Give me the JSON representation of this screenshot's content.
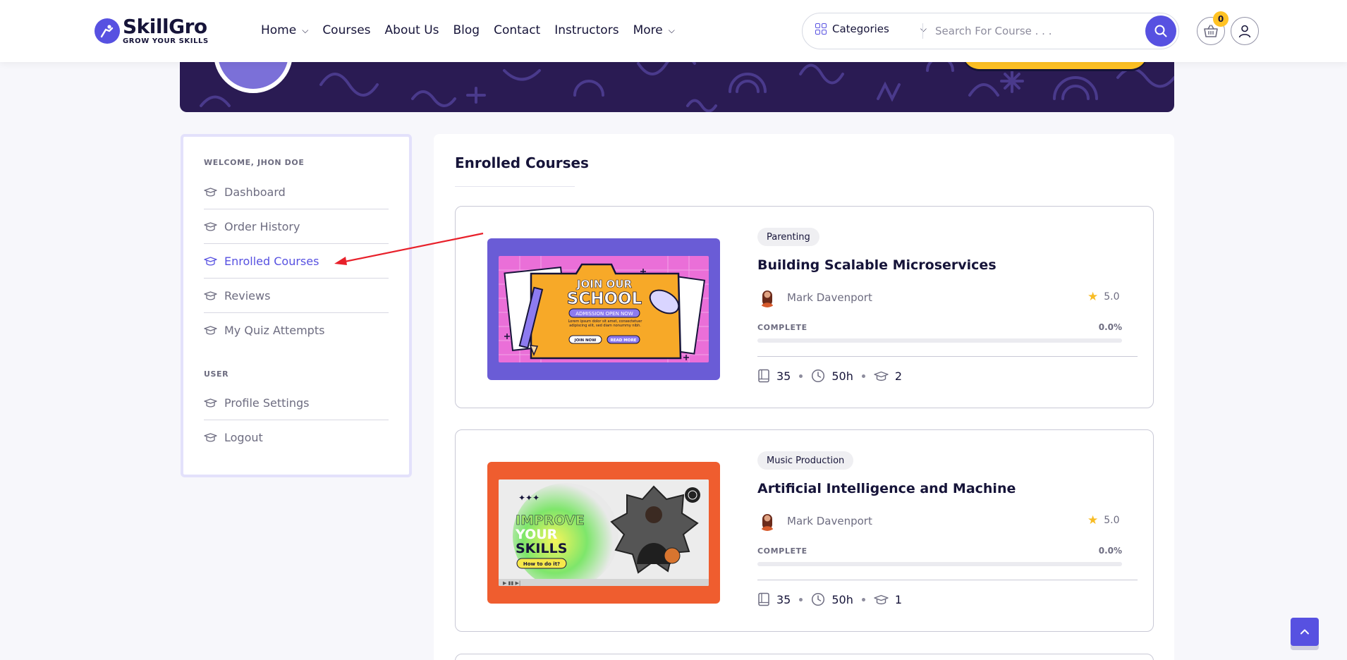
{
  "header": {
    "logo_name": "SkillGro",
    "logo_tagline": "GROW YOUR SKILLS",
    "nav": [
      {
        "label": "Home",
        "has_dropdown": true
      },
      {
        "label": "Courses",
        "has_dropdown": false
      },
      {
        "label": "About Us",
        "has_dropdown": false
      },
      {
        "label": "Blog",
        "has_dropdown": false
      },
      {
        "label": "Contact",
        "has_dropdown": false
      },
      {
        "label": "Instructors",
        "has_dropdown": false
      },
      {
        "label": "More",
        "has_dropdown": true
      }
    ],
    "categories_label": "Categories",
    "search_placeholder": "Search For Course . . .",
    "cart_count": "0"
  },
  "sidebar": {
    "welcome": "WELCOME, JHON DOE",
    "items": [
      {
        "label": "Dashboard"
      },
      {
        "label": "Order History"
      },
      {
        "label": "Enrolled Courses",
        "active": true
      },
      {
        "label": "Reviews"
      },
      {
        "label": "My Quiz Attempts"
      }
    ],
    "user_heading": "USER",
    "user_items": [
      {
        "label": "Profile Settings"
      },
      {
        "label": "Logout"
      }
    ]
  },
  "main": {
    "title": "Enrolled Courses",
    "courses": [
      {
        "category": "Parenting",
        "title": "Building Scalable Microservices",
        "instructor": "Mark Davenport",
        "rating": "5.0",
        "complete_label": "COMPLETE",
        "progress_text": "0.0%",
        "progress": 0,
        "lessons": "35",
        "duration": "50h",
        "students": "2",
        "thumb": {
          "line1": "JOIN OUR",
          "line2": "SCHOOL",
          "ribbon": "ADMISSION OPEN NOW",
          "body": "Lorem ipsum dolor sit amet, consectetuer adipiscing elit, sed diam nonummy nibh.",
          "btn1": "JOIN NOW",
          "btn2": "READ MORE"
        }
      },
      {
        "category": "Music Production",
        "title": "Artificial Intelligence and Machine",
        "instructor": "Mark Davenport",
        "rating": "5.0",
        "complete_label": "COMPLETE",
        "progress_text": "0.0%",
        "progress": 0,
        "lessons": "35",
        "duration": "50h",
        "students": "1",
        "thumb": {
          "line1": "IMPROVE",
          "line2": "YOUR",
          "line3": "SKILLS",
          "pill": "How to do it?"
        }
      }
    ]
  },
  "colors": {
    "primary": "#5751e1",
    "accent": "#ffc224",
    "dark": "#161439",
    "muted": "#6d6c80",
    "annotation_arrow": "#e8202a"
  }
}
